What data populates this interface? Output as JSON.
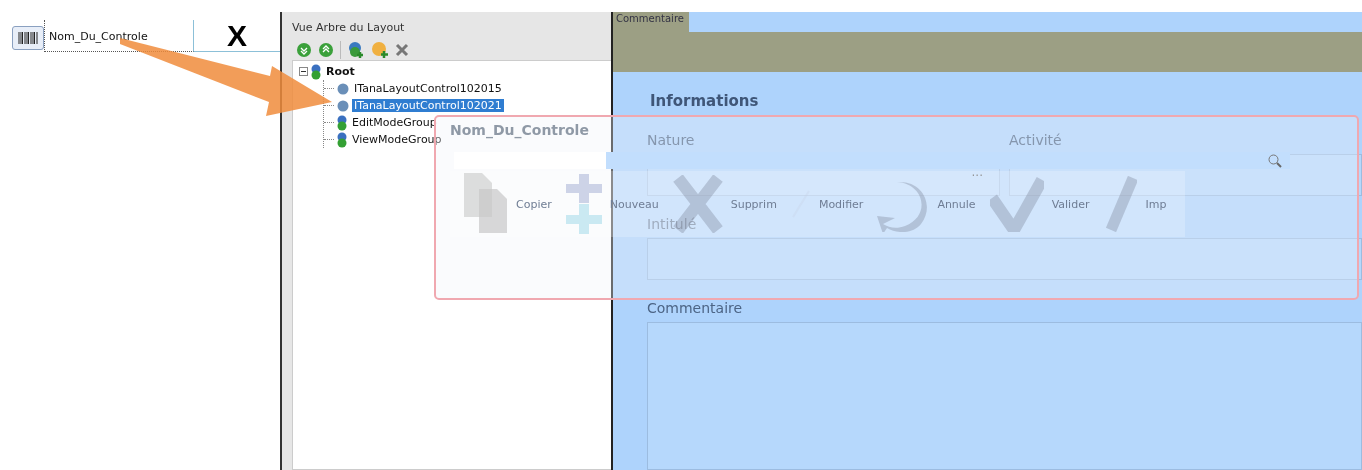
{
  "control": {
    "label": "Nom_Du_Controle",
    "close": "X"
  },
  "layout_tree": {
    "title": "Vue Arbre du Layout",
    "root": {
      "label": "Root",
      "kind": "group",
      "expanded": true,
      "selected": false,
      "children": [
        {
          "label": "ITanaLayoutControl102015",
          "kind": "control",
          "selected": false
        },
        {
          "label": "ITanaLayoutControl102021",
          "kind": "control",
          "selected": true
        },
        {
          "label": "EditModeGroup",
          "kind": "group",
          "selected": false
        },
        {
          "label": "ViewModeGroup",
          "kind": "group",
          "selected": false
        }
      ]
    }
  },
  "form": {
    "tab": "Commentaire",
    "section": "Informations",
    "rows": [
      [
        {
          "label": "Nature",
          "kind": "lookup",
          "button": "..."
        },
        {
          "label": "Activité",
          "kind": "text"
        }
      ],
      [
        {
          "label": "Intitulé",
          "kind": "text"
        }
      ],
      [
        {
          "label": "Commentaire",
          "kind": "memo"
        }
      ]
    ]
  },
  "drag_preview": {
    "title": "Nom_Du_Controle",
    "buttons": [
      {
        "label": "Copier",
        "kind": "copy"
      },
      {
        "label": "Nouveau",
        "kind": "new"
      },
      {
        "label": "Supprim",
        "kind": "delete"
      },
      {
        "label": "Modifier",
        "kind": "edit"
      },
      {
        "label": "Annule",
        "kind": "cancel"
      },
      {
        "label": "Valider",
        "kind": "validate"
      },
      {
        "label": "Imp",
        "kind": "print"
      }
    ]
  }
}
